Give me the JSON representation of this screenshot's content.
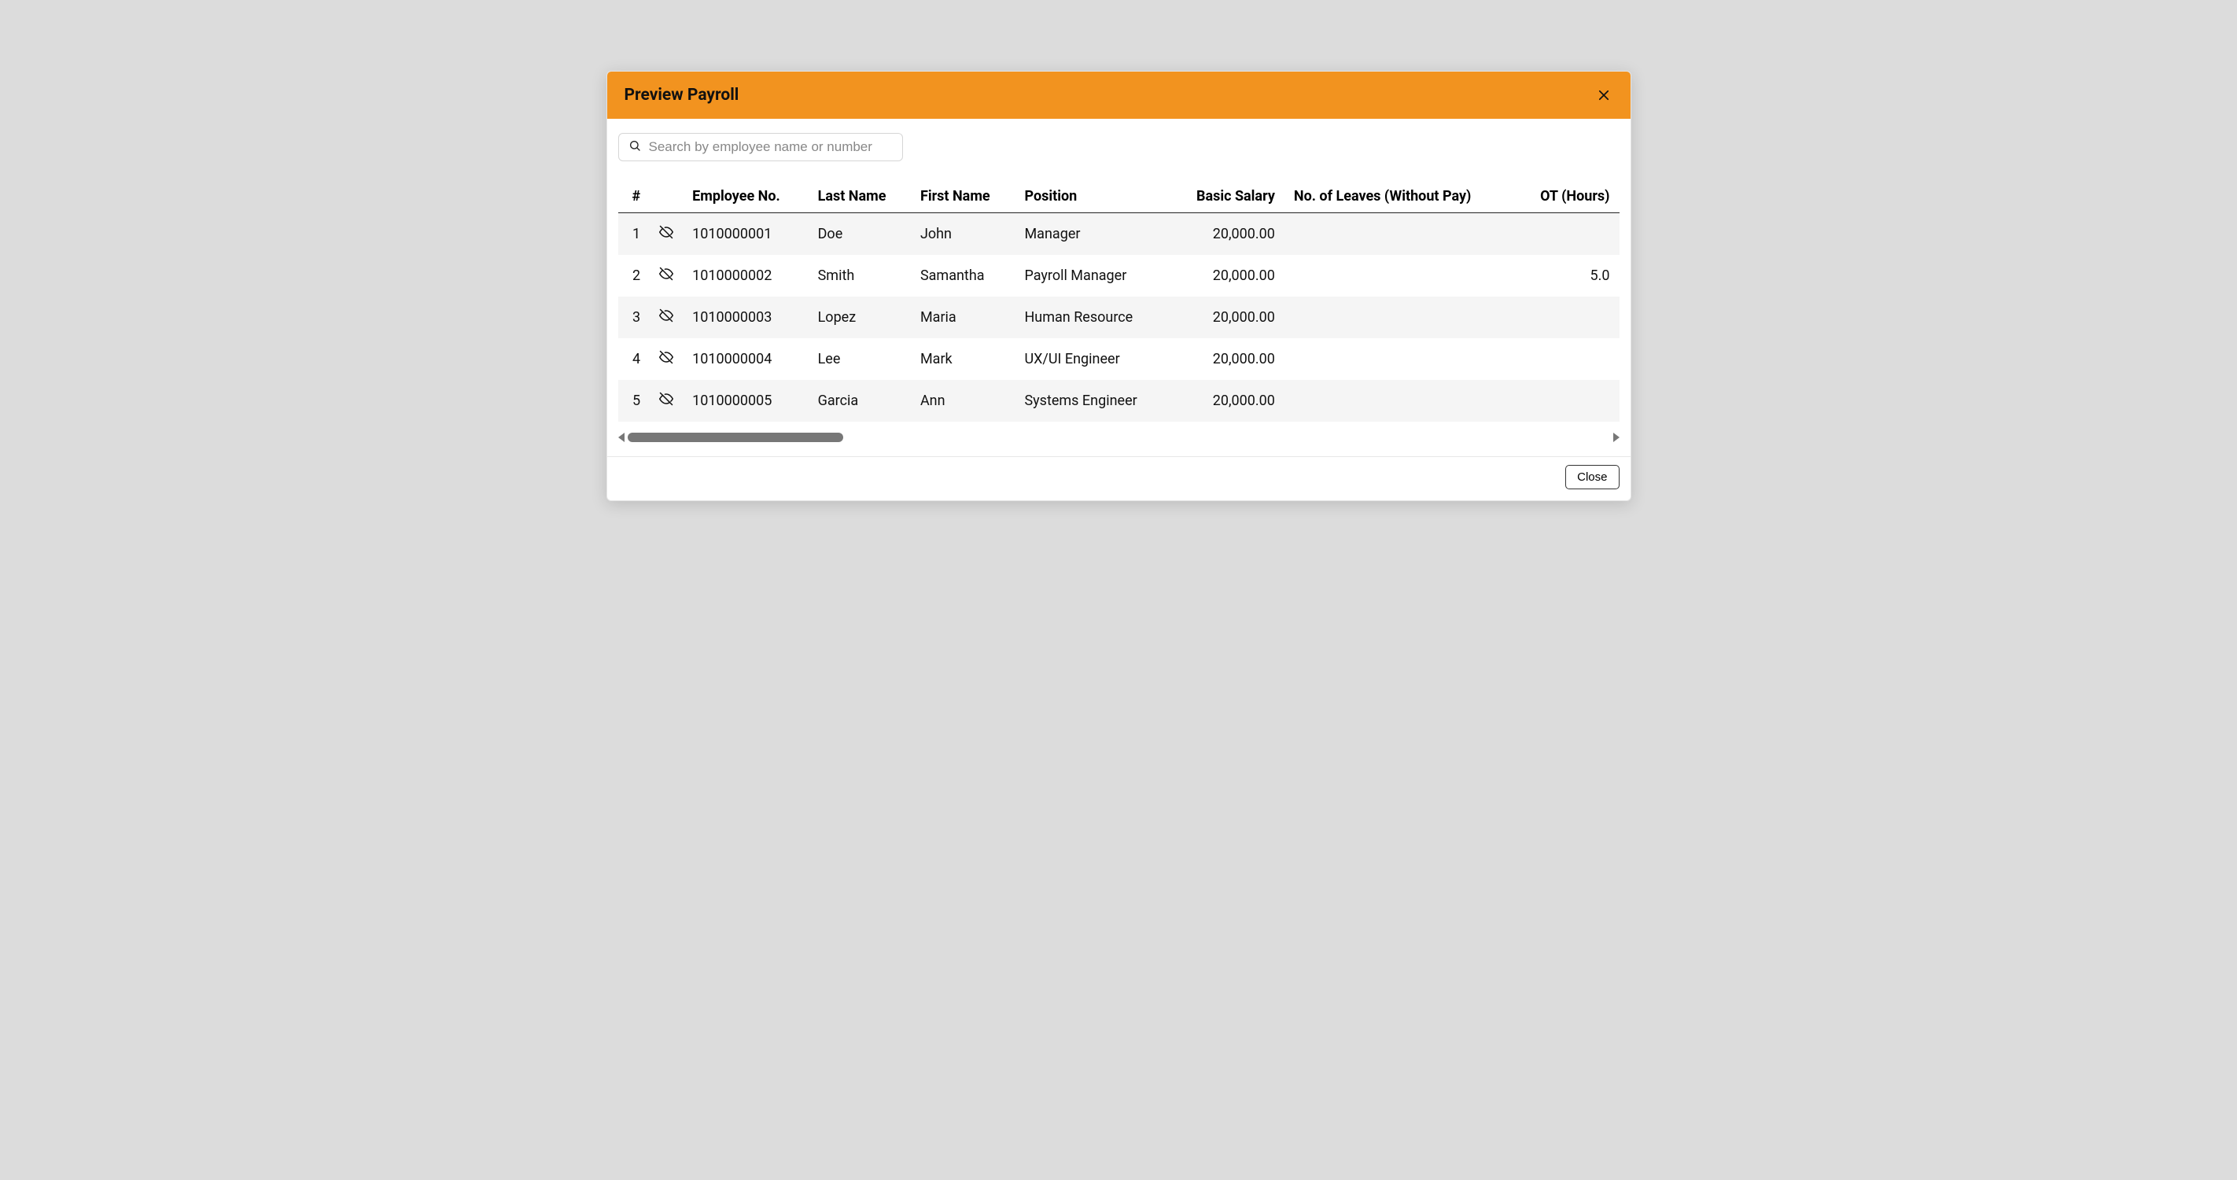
{
  "header": {
    "title": "Preview Payroll"
  },
  "search": {
    "placeholder": "Search by employee name or number"
  },
  "table": {
    "headers": {
      "idx": "#",
      "emp_no": "Employee No.",
      "last_name": "Last Name",
      "first_name": "First Name",
      "position": "Position",
      "basic_salary": "Basic Salary",
      "leaves": "No. of Leaves (Without Pay)",
      "ot": "OT (Hours)"
    },
    "rows": [
      {
        "idx": "1",
        "emp_no": "1010000001",
        "last_name": "Doe",
        "first_name": "John",
        "position": "Manager",
        "basic_salary": "20,000.00",
        "leaves": "",
        "ot": ""
      },
      {
        "idx": "2",
        "emp_no": "1010000002",
        "last_name": "Smith",
        "first_name": "Samantha",
        "position": "Payroll Manager",
        "basic_salary": "20,000.00",
        "leaves": "",
        "ot": "5.0"
      },
      {
        "idx": "3",
        "emp_no": "1010000003",
        "last_name": "Lopez",
        "first_name": "Maria",
        "position": "Human Resource",
        "basic_salary": "20,000.00",
        "leaves": "",
        "ot": ""
      },
      {
        "idx": "4",
        "emp_no": "1010000004",
        "last_name": "Lee",
        "first_name": "Mark",
        "position": "UX/UI Engineer",
        "basic_salary": "20,000.00",
        "leaves": "",
        "ot": ""
      },
      {
        "idx": "5",
        "emp_no": "1010000005",
        "last_name": "Garcia",
        "first_name": "Ann",
        "position": "Systems Engineer",
        "basic_salary": "20,000.00",
        "leaves": "",
        "ot": ""
      }
    ]
  },
  "footer": {
    "close_label": "Close"
  }
}
